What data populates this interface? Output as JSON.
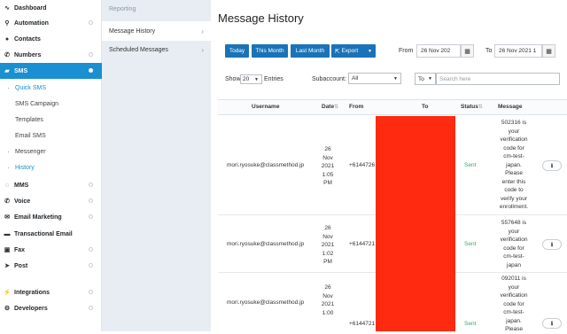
{
  "nav": [
    {
      "label": "Dashboard",
      "icon": "chart-icon"
    },
    {
      "label": "Automation",
      "icon": "automation-icon"
    },
    {
      "label": "Contacts",
      "icon": "contacts-icon"
    },
    {
      "label": "Numbers",
      "icon": "phone-icon"
    },
    {
      "label": "SMS",
      "icon": "chat-icon"
    }
  ],
  "sms_sub": [
    "Quick SMS",
    "SMS Campaign",
    "Templates",
    "Email SMS",
    "Messenger",
    "History"
  ],
  "nav2": [
    {
      "label": "MMS",
      "icon": "mms-icon"
    },
    {
      "label": "Voice",
      "icon": "voice-icon"
    },
    {
      "label": "Email Marketing",
      "icon": "email-icon"
    },
    {
      "label": "Transactional Email",
      "icon": "transactional-email-icon"
    },
    {
      "label": "Fax",
      "icon": "fax-icon"
    },
    {
      "label": "Post",
      "icon": "post-icon"
    },
    {
      "label": "Integrations",
      "icon": "integrations-icon"
    },
    {
      "label": "Developers",
      "icon": "developers-icon"
    }
  ],
  "subnav": {
    "heading": "Reporting",
    "items": [
      "Message History",
      "Scheduled Messages"
    ]
  },
  "main": {
    "title": "Message History",
    "buttons": {
      "today": "Today",
      "this_month": "This Month",
      "last_month": "Last Month",
      "export": "Export"
    },
    "from_label": "From",
    "from_value": "26 Nov 202",
    "to_label": "To",
    "to_value": "26 Nov 2021 1",
    "show_label": "Show",
    "show_value": "20",
    "entries_label": "Entries",
    "subaccount_label": "Subaccount:",
    "subaccount_value": "All",
    "to_select": "To",
    "search_placeholder": "Search here"
  },
  "table": {
    "headers": [
      "Username",
      "Date",
      "From",
      "To",
      "Status",
      "Message"
    ],
    "rows": [
      {
        "username": "mori.ryosuke@classmethod.jp",
        "date": [
          "26",
          "Nov",
          "2021",
          "1:05",
          "PM"
        ],
        "from": "+6144726",
        "status": "Sent",
        "message": [
          "502316 is",
          "your",
          "verification",
          "code for",
          "cm-test-",
          "japan.",
          "Please",
          "enter this",
          "code to",
          "verify your",
          "enrollment."
        ]
      },
      {
        "username": "mori.ryosuke@classmethod.jp",
        "date": [
          "26",
          "Nov",
          "2021",
          "1:02",
          "PM"
        ],
        "from": "+6144721",
        "status": "Sent",
        "message": [
          "557648 is",
          "your",
          "verification",
          "code for",
          "cm-test-",
          "japan"
        ]
      },
      {
        "username": "mori.ryosuke@classmethod.jp",
        "date": [
          "26",
          "Nov",
          "2021",
          "1:00"
        ],
        "from": "+6144721",
        "status": "Sent",
        "message": [
          "092011 is",
          "your",
          "verification",
          "code for",
          "cm-test-",
          "japan.",
          "Please"
        ]
      }
    ]
  },
  "colors": {
    "accent": "#1a8fd1",
    "button": "#1a73b8",
    "sent": "#3aa76d",
    "redaction": "#ff2a10"
  }
}
